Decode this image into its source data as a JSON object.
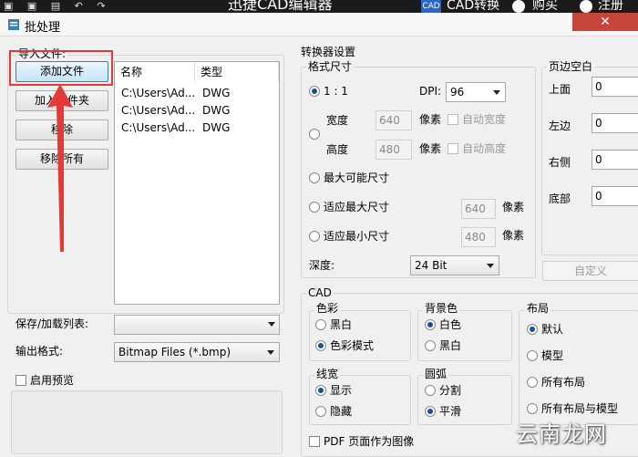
{
  "topbar": {
    "title": "迅捷CAD编辑器",
    "cad_badge": "CAD",
    "convert": "CAD转换",
    "buy": "购买",
    "register": "注册"
  },
  "window": {
    "title": "批处理"
  },
  "import": {
    "group_label": "导入文件:",
    "add_file": "添加文件",
    "add_folder": "加入文件夹",
    "remove": "移除",
    "remove_all": "移除所有",
    "columns": [
      "名称",
      "类型"
    ],
    "rows": [
      {
        "name": "C:\\Users\\Ad...",
        "type": "DWG"
      },
      {
        "name": "C:\\Users\\Ad...",
        "type": "DWG"
      },
      {
        "name": "C:\\Users\\Ad...",
        "type": "DWG"
      }
    ]
  },
  "save_list": {
    "label": "保存/加载列表:",
    "value": ""
  },
  "output": {
    "label": "输出格式:",
    "value": "Bitmap Files (*.bmp)"
  },
  "preview": {
    "label": "启用预览",
    "checked": false
  },
  "converter": {
    "title": "转换器设置",
    "format": {
      "title": "格式尺寸",
      "ratio_label": "1 : 1",
      "dpi_label": "DPI:",
      "dpi_value": "96",
      "width_label": "宽度",
      "width_value": "640",
      "height_label": "高度",
      "height_value": "480",
      "pixels": "像素",
      "auto_width": "自动宽度",
      "auto_height": "自动高度",
      "max_size": "最大可能尺寸",
      "fit_max": "适应最大尺寸",
      "fit_max_value": "640",
      "fit_min": "适应最小尺寸",
      "fit_min_value": "480",
      "depth_label": "深度:",
      "depth_value": "24 Bit"
    },
    "margins": {
      "title": "页边空白",
      "top_label": "上面",
      "top_value": "0",
      "left_label": "左边",
      "left_value": "0",
      "right_label": "右侧",
      "right_value": "0",
      "bottom_label": "底部",
      "bottom_value": "0",
      "custom": "自定义"
    }
  },
  "cad": {
    "title": "CAD",
    "color": {
      "title": "色彩",
      "bw": "黑白",
      "color_mode": "色彩模式"
    },
    "background": {
      "title": "背景色",
      "white": "白色",
      "black": "黑白"
    },
    "layout": {
      "title": "布局",
      "default": "默认",
      "model": "模型",
      "all": "所有布局",
      "all_model": "所有布局与模型"
    },
    "linewidth": {
      "title": "线宽",
      "show": "显示",
      "hide": "隐藏"
    },
    "arc": {
      "title": "圆弧",
      "split": "分割",
      "smooth": "平滑"
    },
    "pdf_page": "PDF 页面作为图像"
  },
  "watermark": "云南龙网",
  "colors": {
    "highlight": "#e53935",
    "close": "#c7443a",
    "accent": "#1a4f9c"
  }
}
